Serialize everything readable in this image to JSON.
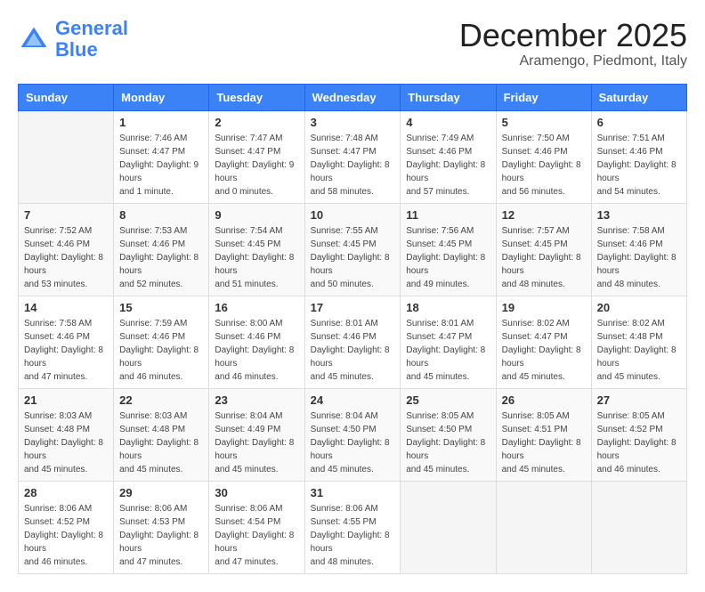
{
  "header": {
    "logo_general": "General",
    "logo_blue": "Blue",
    "title": "December 2025",
    "subtitle": "Aramengo, Piedmont, Italy"
  },
  "calendar": {
    "days_of_week": [
      "Sunday",
      "Monday",
      "Tuesday",
      "Wednesday",
      "Thursday",
      "Friday",
      "Saturday"
    ],
    "weeks": [
      [
        {
          "day": "",
          "sunrise": "",
          "sunset": "",
          "daylight": ""
        },
        {
          "day": "1",
          "sunrise": "Sunrise: 7:46 AM",
          "sunset": "Sunset: 4:47 PM",
          "daylight": "Daylight: 9 hours and 1 minute."
        },
        {
          "day": "2",
          "sunrise": "Sunrise: 7:47 AM",
          "sunset": "Sunset: 4:47 PM",
          "daylight": "Daylight: 9 hours and 0 minutes."
        },
        {
          "day": "3",
          "sunrise": "Sunrise: 7:48 AM",
          "sunset": "Sunset: 4:47 PM",
          "daylight": "Daylight: 8 hours and 58 minutes."
        },
        {
          "day": "4",
          "sunrise": "Sunrise: 7:49 AM",
          "sunset": "Sunset: 4:46 PM",
          "daylight": "Daylight: 8 hours and 57 minutes."
        },
        {
          "day": "5",
          "sunrise": "Sunrise: 7:50 AM",
          "sunset": "Sunset: 4:46 PM",
          "daylight": "Daylight: 8 hours and 56 minutes."
        },
        {
          "day": "6",
          "sunrise": "Sunrise: 7:51 AM",
          "sunset": "Sunset: 4:46 PM",
          "daylight": "Daylight: 8 hours and 54 minutes."
        }
      ],
      [
        {
          "day": "7",
          "sunrise": "Sunrise: 7:52 AM",
          "sunset": "Sunset: 4:46 PM",
          "daylight": "Daylight: 8 hours and 53 minutes."
        },
        {
          "day": "8",
          "sunrise": "Sunrise: 7:53 AM",
          "sunset": "Sunset: 4:46 PM",
          "daylight": "Daylight: 8 hours and 52 minutes."
        },
        {
          "day": "9",
          "sunrise": "Sunrise: 7:54 AM",
          "sunset": "Sunset: 4:45 PM",
          "daylight": "Daylight: 8 hours and 51 minutes."
        },
        {
          "day": "10",
          "sunrise": "Sunrise: 7:55 AM",
          "sunset": "Sunset: 4:45 PM",
          "daylight": "Daylight: 8 hours and 50 minutes."
        },
        {
          "day": "11",
          "sunrise": "Sunrise: 7:56 AM",
          "sunset": "Sunset: 4:45 PM",
          "daylight": "Daylight: 8 hours and 49 minutes."
        },
        {
          "day": "12",
          "sunrise": "Sunrise: 7:57 AM",
          "sunset": "Sunset: 4:45 PM",
          "daylight": "Daylight: 8 hours and 48 minutes."
        },
        {
          "day": "13",
          "sunrise": "Sunrise: 7:58 AM",
          "sunset": "Sunset: 4:46 PM",
          "daylight": "Daylight: 8 hours and 48 minutes."
        }
      ],
      [
        {
          "day": "14",
          "sunrise": "Sunrise: 7:58 AM",
          "sunset": "Sunset: 4:46 PM",
          "daylight": "Daylight: 8 hours and 47 minutes."
        },
        {
          "day": "15",
          "sunrise": "Sunrise: 7:59 AM",
          "sunset": "Sunset: 4:46 PM",
          "daylight": "Daylight: 8 hours and 46 minutes."
        },
        {
          "day": "16",
          "sunrise": "Sunrise: 8:00 AM",
          "sunset": "Sunset: 4:46 PM",
          "daylight": "Daylight: 8 hours and 46 minutes."
        },
        {
          "day": "17",
          "sunrise": "Sunrise: 8:01 AM",
          "sunset": "Sunset: 4:46 PM",
          "daylight": "Daylight: 8 hours and 45 minutes."
        },
        {
          "day": "18",
          "sunrise": "Sunrise: 8:01 AM",
          "sunset": "Sunset: 4:47 PM",
          "daylight": "Daylight: 8 hours and 45 minutes."
        },
        {
          "day": "19",
          "sunrise": "Sunrise: 8:02 AM",
          "sunset": "Sunset: 4:47 PM",
          "daylight": "Daylight: 8 hours and 45 minutes."
        },
        {
          "day": "20",
          "sunrise": "Sunrise: 8:02 AM",
          "sunset": "Sunset: 4:48 PM",
          "daylight": "Daylight: 8 hours and 45 minutes."
        }
      ],
      [
        {
          "day": "21",
          "sunrise": "Sunrise: 8:03 AM",
          "sunset": "Sunset: 4:48 PM",
          "daylight": "Daylight: 8 hours and 45 minutes."
        },
        {
          "day": "22",
          "sunrise": "Sunrise: 8:03 AM",
          "sunset": "Sunset: 4:48 PM",
          "daylight": "Daylight: 8 hours and 45 minutes."
        },
        {
          "day": "23",
          "sunrise": "Sunrise: 8:04 AM",
          "sunset": "Sunset: 4:49 PM",
          "daylight": "Daylight: 8 hours and 45 minutes."
        },
        {
          "day": "24",
          "sunrise": "Sunrise: 8:04 AM",
          "sunset": "Sunset: 4:50 PM",
          "daylight": "Daylight: 8 hours and 45 minutes."
        },
        {
          "day": "25",
          "sunrise": "Sunrise: 8:05 AM",
          "sunset": "Sunset: 4:50 PM",
          "daylight": "Daylight: 8 hours and 45 minutes."
        },
        {
          "day": "26",
          "sunrise": "Sunrise: 8:05 AM",
          "sunset": "Sunset: 4:51 PM",
          "daylight": "Daylight: 8 hours and 45 minutes."
        },
        {
          "day": "27",
          "sunrise": "Sunrise: 8:05 AM",
          "sunset": "Sunset: 4:52 PM",
          "daylight": "Daylight: 8 hours and 46 minutes."
        }
      ],
      [
        {
          "day": "28",
          "sunrise": "Sunrise: 8:06 AM",
          "sunset": "Sunset: 4:52 PM",
          "daylight": "Daylight: 8 hours and 46 minutes."
        },
        {
          "day": "29",
          "sunrise": "Sunrise: 8:06 AM",
          "sunset": "Sunset: 4:53 PM",
          "daylight": "Daylight: 8 hours and 47 minutes."
        },
        {
          "day": "30",
          "sunrise": "Sunrise: 8:06 AM",
          "sunset": "Sunset: 4:54 PM",
          "daylight": "Daylight: 8 hours and 47 minutes."
        },
        {
          "day": "31",
          "sunrise": "Sunrise: 8:06 AM",
          "sunset": "Sunset: 4:55 PM",
          "daylight": "Daylight: 8 hours and 48 minutes."
        },
        {
          "day": "",
          "sunrise": "",
          "sunset": "",
          "daylight": ""
        },
        {
          "day": "",
          "sunrise": "",
          "sunset": "",
          "daylight": ""
        },
        {
          "day": "",
          "sunrise": "",
          "sunset": "",
          "daylight": ""
        }
      ]
    ]
  }
}
